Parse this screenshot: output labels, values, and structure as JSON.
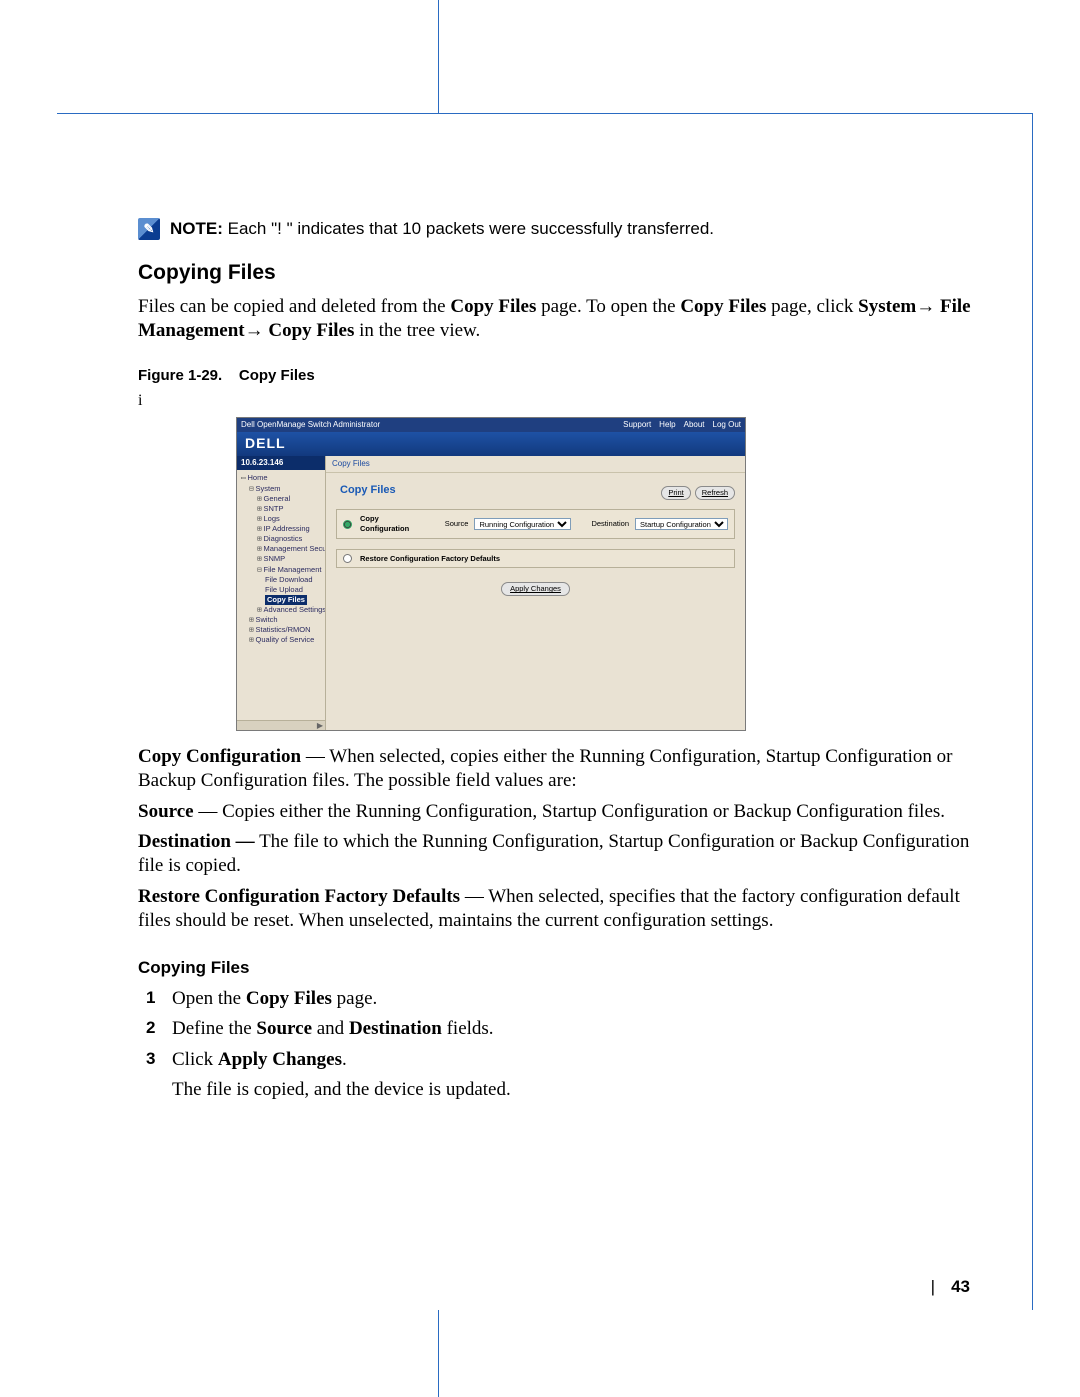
{
  "note": {
    "label": "NOTE:",
    "text": "Each \"! \" indicates that 10 packets were successfully transferred."
  },
  "section_title": "Copying Files",
  "intro": {
    "pre": "Files can be copied and deleted from the ",
    "b1": "Copy Files",
    "mid1": " page. To open the ",
    "b2": "Copy Files",
    "mid2": " page, click ",
    "path1": "System",
    "arrow": "→ ",
    "path2": "File Management",
    "path3": "Copy Files",
    "post": " in the tree view."
  },
  "figure": {
    "caption_prefix": "Figure 1-29.",
    "caption_title": "Copy Files",
    "marginal_i": "i"
  },
  "screenshot": {
    "window_title": "Dell OpenManage Switch Administrator",
    "header_links": [
      "Support",
      "Help",
      "About",
      "Log Out"
    ],
    "brand": "DELL",
    "ip": "10.6.23.146",
    "breadcrumb": "Copy Files",
    "panel_title": "Copy Files",
    "print_label": "Print",
    "refresh_label": "Refresh",
    "tree": {
      "home": "Home",
      "system": "System",
      "children": [
        "General",
        "SNTP",
        "Logs",
        "IP Addressing",
        "Diagnostics",
        "Management Secu",
        "SNMP"
      ],
      "file_mgmt": "File Management",
      "file_children": [
        "File Download",
        "File Upload"
      ],
      "copy_files": "Copy Files",
      "adv": "Advanced Settings",
      "rest": [
        "Switch",
        "Statistics/RMON",
        "Quality of Service"
      ]
    },
    "form": {
      "copy_label": "Copy Configuration",
      "source_label": "Source",
      "source_value": "Running Configuration",
      "dest_label": "Destination",
      "dest_value": "Startup Configuration",
      "restore_label": "Restore Configuration Factory Defaults",
      "apply_label": "Apply Changes"
    }
  },
  "definitions": {
    "copy_cfg": {
      "term": "Copy Configuration",
      "text": " — When selected, copies either the Running Configuration, Startup Configuration or Backup Configuration files. The possible field values are:"
    },
    "source": {
      "term": "Source",
      "text": " — Copies either the Running Configuration, Startup Configuration or Backup Configuration files."
    },
    "destination": {
      "term": "Destination —",
      "text": " The file to which the Running Configuration, Startup Configuration or Backup Configuration file is copied."
    },
    "restore": {
      "term": "Restore Configuration Factory Defaults",
      "text": " — When selected, specifies that the factory configuration default files should be reset. When unselected, maintains the current configuration settings."
    }
  },
  "procedure": {
    "title": "Copying Files",
    "steps": {
      "s1_pre": "Open the ",
      "s1_b": "Copy Files",
      "s1_post": " page.",
      "s2_pre": "Define the ",
      "s2_b1": "Source",
      "s2_mid": " and ",
      "s2_b2": "Destination",
      "s2_post": " fields.",
      "s3_pre": "Click ",
      "s3_b": "Apply Changes",
      "s3_post": "."
    },
    "result": "The file is copied, and the device is updated."
  },
  "page_number": "43"
}
